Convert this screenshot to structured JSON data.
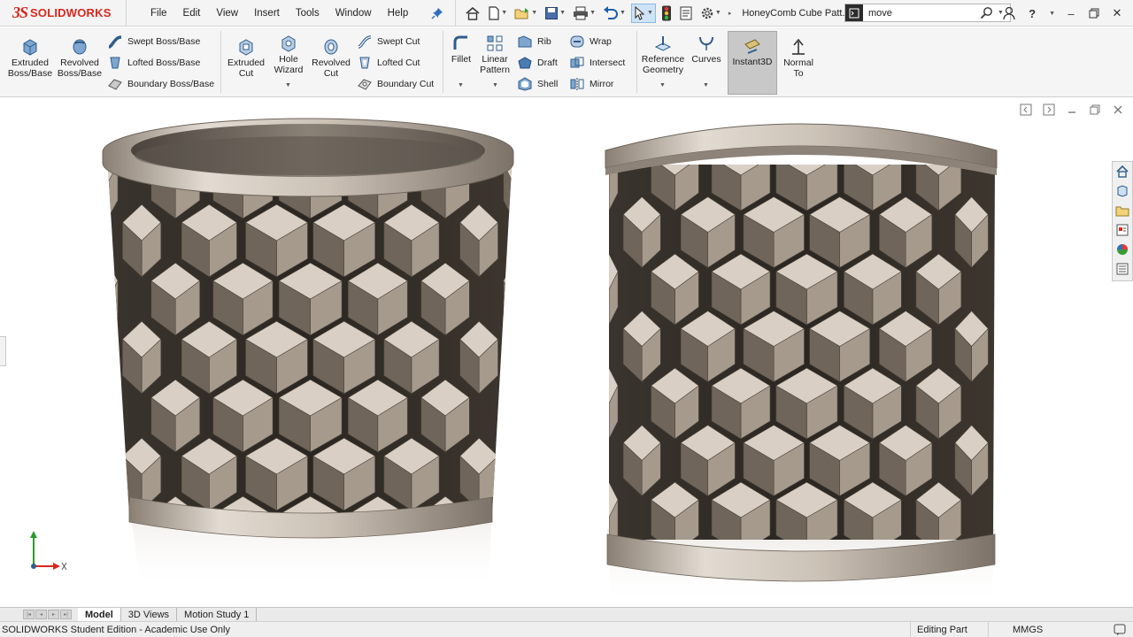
{
  "app": {
    "logo_prefix": "3S",
    "logo_text": "SOLIDWORKS",
    "document_title": "HoneyComb Cube Patt..."
  },
  "menu": [
    "File",
    "Edit",
    "View",
    "Insert",
    "Tools",
    "Window",
    "Help"
  ],
  "search": {
    "value": "move"
  },
  "ribbon": {
    "extruded_boss": "Extruded Boss/Base",
    "revolved_boss": "Revolved Boss/Base",
    "swept_boss": "Swept Boss/Base",
    "lofted_boss": "Lofted Boss/Base",
    "boundary_boss": "Boundary Boss/Base",
    "extruded_cut": "Extruded Cut",
    "hole_wizard": "Hole Wizard",
    "revolved_cut": "Revolved Cut",
    "swept_cut": "Swept Cut",
    "lofted_cut": "Lofted Cut",
    "boundary_cut": "Boundary Cut",
    "fillet": "Fillet",
    "linear_pattern": "Linear Pattern",
    "rib": "Rib",
    "draft": "Draft",
    "shell": "Shell",
    "wrap": "Wrap",
    "intersect": "Intersect",
    "mirror": "Mirror",
    "reference_geometry": "Reference Geometry",
    "curves": "Curves",
    "instant3d": "Instant3D",
    "normal_to": "Normal To"
  },
  "tabs": [
    {
      "label": "Model",
      "active": true
    },
    {
      "label": "3D Views",
      "active": false
    },
    {
      "label": "Motion Study 1",
      "active": false
    }
  ],
  "status": {
    "edition": "SOLIDWORKS Student Edition - Academic Use Only",
    "mode": "Editing Part",
    "units": "MMGS"
  },
  "colors": {
    "brand_red": "#d9261c",
    "metal_light": "#d9cfc4",
    "metal_mid": "#a69a8d",
    "metal_dark": "#6f655a"
  }
}
